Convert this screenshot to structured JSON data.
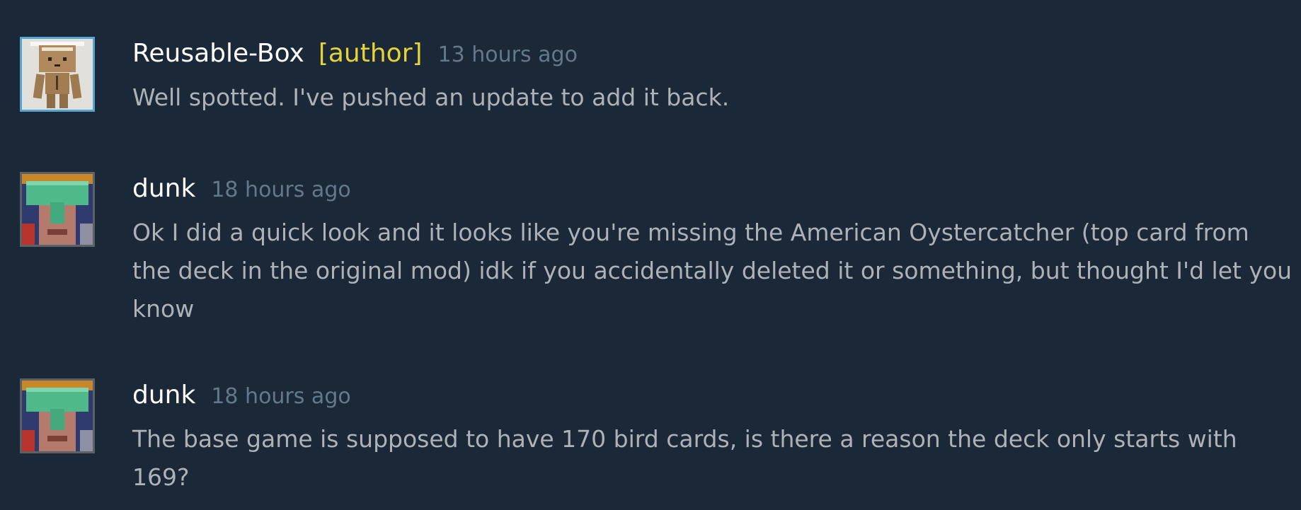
{
  "comments": [
    {
      "author": "Reusable-Box",
      "badge": "[author]",
      "time": "13 hours ago",
      "text": "Well spotted. I've pushed an update to add it back.",
      "avatar_icon": "box-robot-avatar-icon"
    },
    {
      "author": "dunk",
      "time": "18 hours ago",
      "text": "Ok I did a quick look and it looks like you're missing the American Oystercatcher (top card from the deck in the original mod) idk if you accidentally deleted it or something, but thought I'd let you know",
      "avatar_icon": "user-avatar-icon"
    },
    {
      "author": "dunk",
      "time": "18 hours ago",
      "text": "The base game is supposed to have 170 bird cards, is there a reason the deck only starts with 169?",
      "avatar_icon": "user-avatar-icon"
    }
  ],
  "colors": {
    "background": "#1b2838",
    "author_name": "#ffffff",
    "author_badge": "#e5d33a",
    "timestamp": "#63798b",
    "comment_text": "#acb2b8",
    "author_avatar_border": "#57a3d1",
    "user_avatar_border": "#5c6166"
  }
}
